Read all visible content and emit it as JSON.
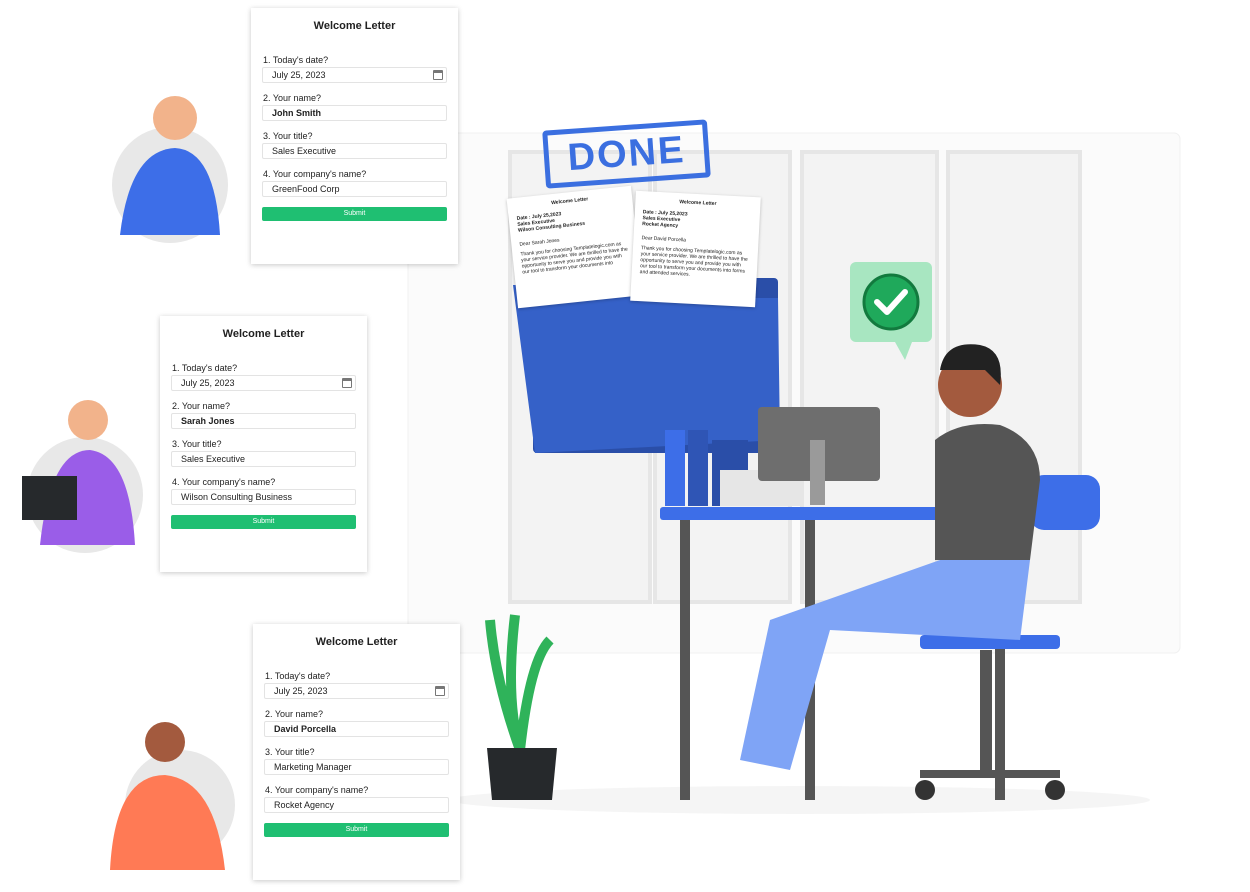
{
  "forms": [
    {
      "title": "Welcome Letter",
      "q1": "1. Today's date?",
      "date": "July 25, 2023",
      "q2": "2. Your name?",
      "name": "John Smith",
      "q3": "3. Your title?",
      "job": "Sales Executive",
      "q4": "4. Your company's name?",
      "company": "GreenFood Corp",
      "submit": "Submit"
    },
    {
      "title": "Welcome Letter",
      "q1": "1. Today's date?",
      "date": "July 25, 2023",
      "q2": "2. Your name?",
      "name": "Sarah Jones",
      "q3": "3. Your title?",
      "job": "Sales Executive",
      "q4": "4. Your company's name?",
      "company": "Wilson Consulting Business",
      "submit": "Submit"
    },
    {
      "title": "Welcome Letter",
      "q1": "1. Today's date?",
      "date": "July 25, 2023",
      "q2": "2. Your name?",
      "name": "David Porcella",
      "q3": "3. Your title?",
      "job": "Marketing Manager",
      "q4": "4. Your company's name?",
      "company": "Rocket Agency",
      "submit": "Submit"
    }
  ],
  "stamp": "DONE",
  "letters": [
    {
      "title": "Welcome Letter",
      "date": "Date : July 25,2023",
      "job": "Sales Executive",
      "company": "Wilson Consulting Business",
      "dear": "Dear Sarah Jones",
      "body": "Thank you for choosing Templatelogic.com as your service provider. We are thrilled to have the opportunity to serve you and provide you with our tool to transform your documents into"
    },
    {
      "title": "Welcome Letter",
      "date": "Date : July 25,2023",
      "job": "Sales Executive",
      "company": "Rocket Agency",
      "dear": "Dear David Porcella",
      "body": "Thank you for choosing Templatelogic.com as your service provider. We are thrilled to have the opportunity to serve you and provide you with our tool to transform your documents into forms and attended services."
    }
  ],
  "colors": {
    "accent": "#1fbf72",
    "folder": "#2f55b5",
    "desk": "#3d6ee8",
    "stamp": "#3b6fe0"
  }
}
